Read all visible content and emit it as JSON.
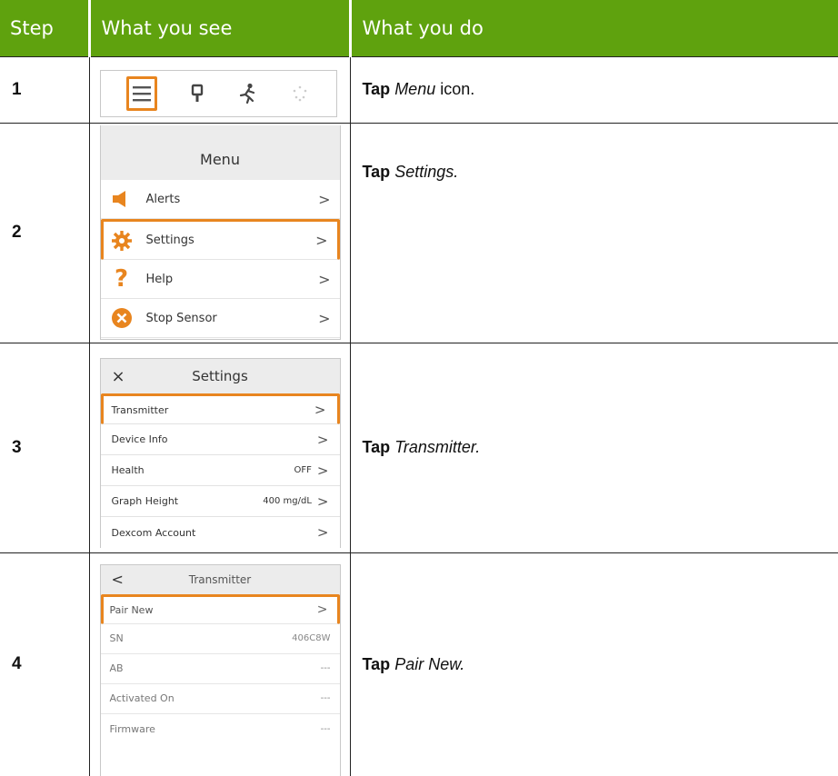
{
  "header": {
    "col_step": "Step",
    "col_see": "What you see",
    "col_do": "What you do"
  },
  "rows": [
    {
      "num": "1",
      "action_verb": "Tap",
      "action_target": "Menu",
      "action_suffix": " icon."
    },
    {
      "num": "2",
      "action_verb": "Tap",
      "action_target": "Settings.",
      "action_suffix": "",
      "screen": {
        "title": "Menu",
        "items": [
          "Alerts",
          "Settings",
          "Help",
          "Stop Sensor"
        ],
        "chevron": ">"
      }
    },
    {
      "num": "3",
      "action_verb": "Tap",
      "action_target": "Transmitter.",
      "action_suffix": "",
      "screen": {
        "close": "×",
        "title": "Settings",
        "items": [
          {
            "label": "Transmitter",
            "value": ""
          },
          {
            "label": "Device Info",
            "value": ""
          },
          {
            "label": "Health",
            "value": "OFF"
          },
          {
            "label": "Graph Height",
            "value": "400 mg/dL"
          },
          {
            "label": "Dexcom Account",
            "value": ""
          }
        ],
        "chevron": ">"
      }
    },
    {
      "num": "4",
      "action_verb": "Tap",
      "action_target": "Pair New.",
      "action_suffix": "",
      "screen": {
        "back": "<",
        "title": "Transmitter",
        "items": [
          {
            "label": "Pair New",
            "value": ">"
          },
          {
            "label": "SN",
            "value": "406C8W"
          },
          {
            "label": "AB",
            "value": "---"
          },
          {
            "label": "Activated On",
            "value": "---"
          },
          {
            "label": "Firmware",
            "value": "---"
          }
        ]
      }
    }
  ],
  "colors": {
    "header_green": "#5fa20e",
    "highlight_orange": "#e8851f"
  }
}
